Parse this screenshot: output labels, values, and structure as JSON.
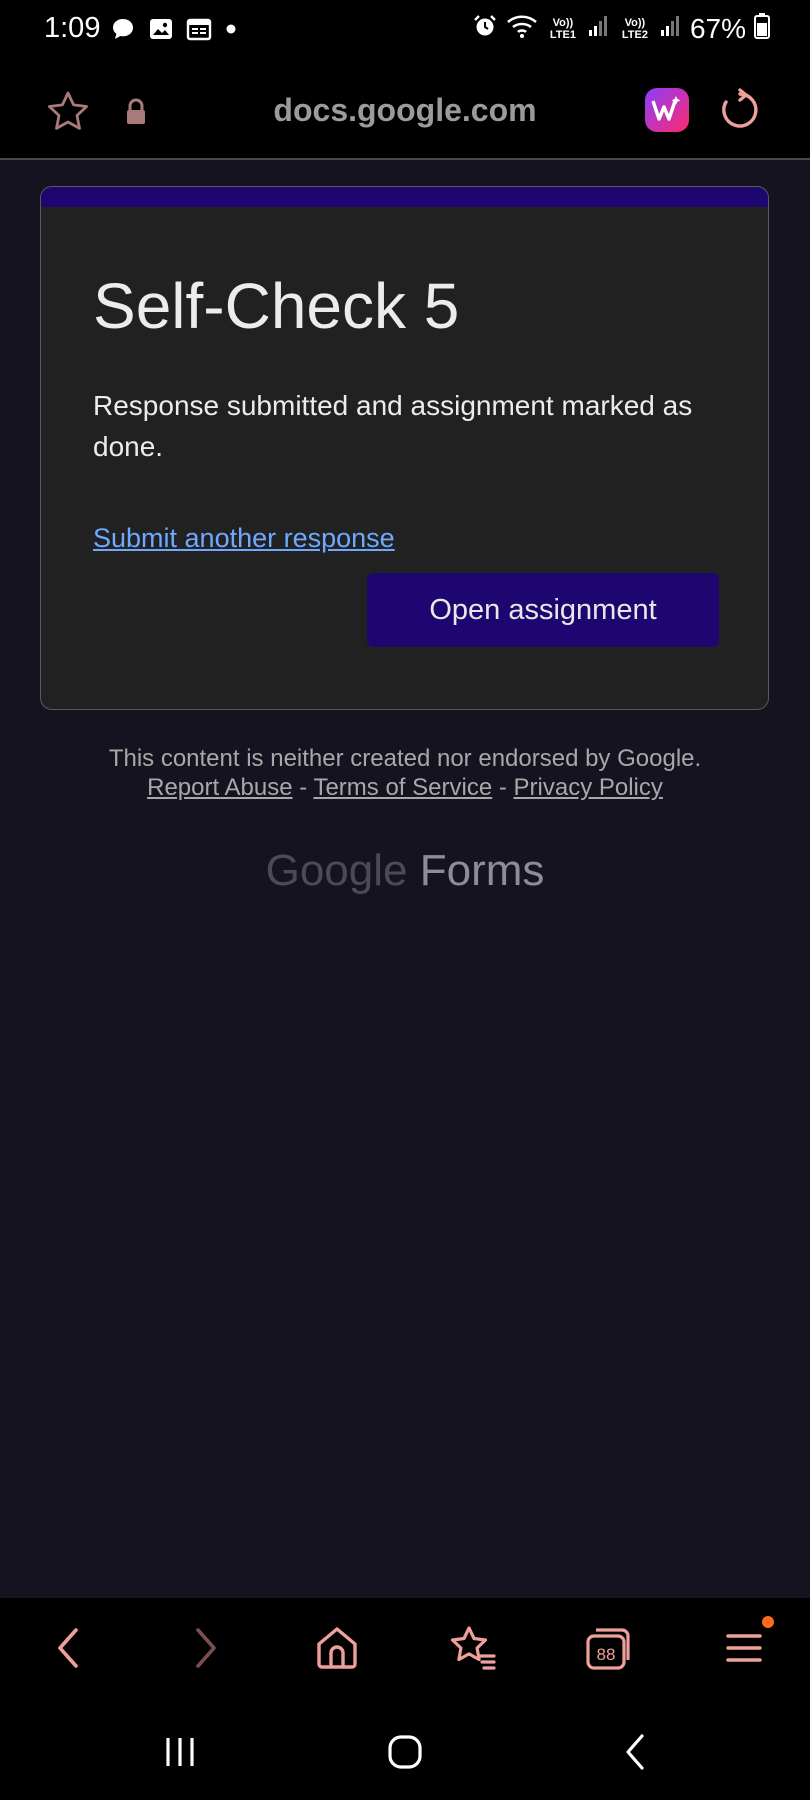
{
  "status_bar": {
    "time": "1:09",
    "battery": "67%",
    "sim1_label": "Vo)) LTE1",
    "sim2_label": "Vo)) LTE2",
    "icons": [
      "chat-icon",
      "gallery-icon",
      "calendar-icon",
      "dot-icon",
      "alarm-icon",
      "wifi-icon",
      "signal-icon",
      "battery-icon"
    ]
  },
  "browser": {
    "url": "docs.google.com",
    "icons": [
      "star-icon",
      "lock-icon",
      "extension-icon",
      "reload-icon"
    ]
  },
  "card": {
    "title": "Self-Check 5",
    "message": "Response submitted and assignment marked as done.",
    "link": "Submit another response",
    "button": "Open assignment",
    "accent_color": "#1e0670"
  },
  "footer": {
    "disclaimer": "This content is neither created nor endorsed by Google.",
    "links": [
      "Report Abuse",
      "Terms of Service",
      "Privacy Policy"
    ],
    "separator": "-",
    "logo_google": "Google",
    "logo_forms": "Forms"
  },
  "bottom_nav": {
    "tab_count": "88",
    "icons": [
      "back-icon",
      "forward-icon",
      "home-icon",
      "bookmarks-icon",
      "tabs-icon",
      "menu-icon"
    ]
  },
  "system_nav": {
    "icons": [
      "recents-icon",
      "home-circle-icon",
      "system-back-icon"
    ]
  }
}
